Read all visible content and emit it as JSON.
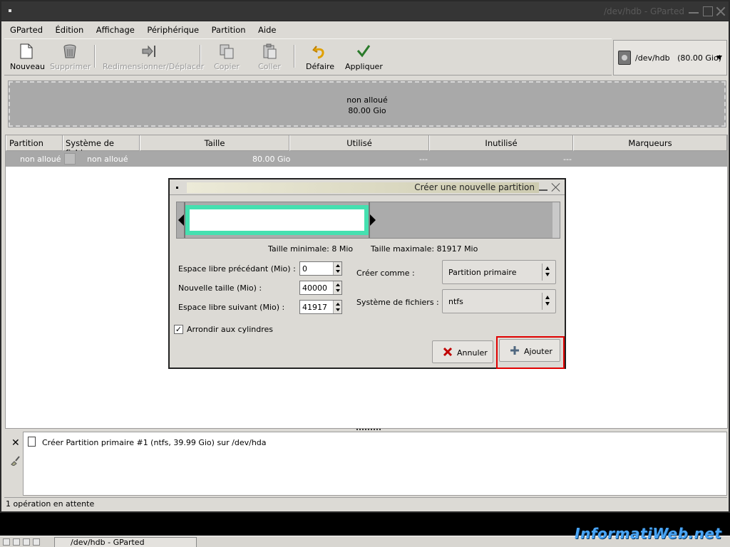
{
  "window": {
    "title": "/dev/hdb - GParted"
  },
  "menubar": {
    "items": [
      "GParted",
      "Édition",
      "Affichage",
      "Périphérique",
      "Partition",
      "Aide"
    ]
  },
  "toolbar": {
    "nouveau": "Nouveau",
    "supprimer": "Supprimer",
    "redimensionner": "Redimensionner/Déplacer",
    "copier": "Copier",
    "coller": "Coller",
    "defaire": "Défaire",
    "appliquer": "Appliquer"
  },
  "device_selector": {
    "label": "/dev/hdb",
    "size": "(80.00 Gio)"
  },
  "disk_map": {
    "label": "non alloué",
    "size": "80.00 Gio"
  },
  "table": {
    "headers": [
      "Partition",
      "Système de fichiers",
      "Taille",
      "Utilisé",
      "Inutilisé",
      "Marqueurs"
    ],
    "rows": [
      {
        "partition": "non alloué",
        "filesystem": "non alloué",
        "size": "80.00 Gio",
        "used": "---",
        "unused": "---"
      }
    ]
  },
  "dialog": {
    "title": "Créer une nouvelle partition",
    "min_size": "Taille minimale: 8 Mio",
    "max_size": "Taille maximale: 81917 Mio",
    "free_before_label": "Espace libre précédant (Mio) :",
    "free_before_value": "0",
    "new_size_label": "Nouvelle taille (Mio) :",
    "new_size_value": "40000",
    "free_after_label": "Espace libre suivant (Mio) :",
    "free_after_value": "41917",
    "create_as_label": "Créer comme :",
    "create_as_value": "Partition primaire",
    "filesystem_label": "Système de fichiers :",
    "filesystem_value": "ntfs",
    "round_cylinders_label": "Arrondir aux cylindres",
    "round_cylinders_checked": true,
    "cancel_label": "Annuler",
    "add_label": "Ajouter",
    "partition_fraction": 0.488
  },
  "log": {
    "entry": "Créer Partition primaire #1 (ntfs, 39.99 Gio) sur /dev/hda"
  },
  "status": {
    "text": "1 opération en attente"
  },
  "taskbar": {
    "task": "/dev/hdb - GParted"
  },
  "watermark": "InformatiWeb.net",
  "colors": {
    "partition_border": "#45e0b0",
    "highlight": "#e00000",
    "unallocated": "#a9a9a9"
  }
}
